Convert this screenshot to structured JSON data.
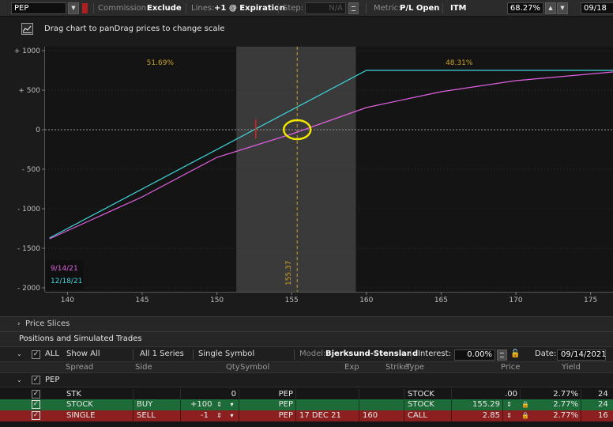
{
  "toolbar": {
    "symbol": "PEP",
    "commission_label": "Commission:",
    "commission_value": "Exclude",
    "lines_label": "Lines:",
    "lines_value": "+1 @ Expiration",
    "step_label": "Step:",
    "step_value": "N/A",
    "metric_label": "Metric:",
    "metric_value": "P/L Open",
    "itm_label": "ITM",
    "itm_value": "68.27%",
    "date_value": "09/18"
  },
  "hint": {
    "text": "Drag chart to panDrag prices to change scale"
  },
  "chart_data": {
    "type": "line",
    "x_ticks": [
      140,
      145,
      150,
      155,
      160,
      165,
      170,
      175
    ],
    "y_ticks": [
      "+ 1000",
      "+ 500",
      "0",
      "- 500",
      "- 1000",
      "- 1500",
      "- 2000"
    ],
    "y_tick_values": [
      1000,
      500,
      0,
      -500,
      -1000,
      -1500,
      -2000
    ],
    "xlim": [
      138.5,
      176.5
    ],
    "ylim": [
      -2050,
      1050
    ],
    "shaded_range": [
      151.3,
      159.3
    ],
    "current_price": 155.37,
    "current_price_label": "155.37",
    "breakeven_marker_x": 152.6,
    "probability_left": "51.69%",
    "probability_right": "48.31%",
    "series": [
      {
        "name": "9/14/21",
        "color": "#e060e0",
        "points": [
          [
            138.8,
            -1380
          ],
          [
            145,
            -850
          ],
          [
            150,
            -350
          ],
          [
            155,
            -55
          ],
          [
            160,
            280
          ],
          [
            165,
            480
          ],
          [
            170,
            620
          ],
          [
            176.5,
            730
          ]
        ]
      },
      {
        "name": "12/18/21",
        "color": "#3fd6dc",
        "points": [
          [
            138.8,
            -1370
          ],
          [
            160,
            750
          ],
          [
            176.5,
            750
          ]
        ]
      }
    ]
  },
  "price_slices": {
    "label": "Price Slices"
  },
  "positions": {
    "title": "Positions and Simulated Trades",
    "filters": {
      "all_label": "ALL",
      "show": "Show All",
      "series": "All 1 Series",
      "symbol_filter": "Single Symbol",
      "model_label": "Model:",
      "model_value": "Bjerksund-Stensland",
      "interest_label": "Interest:",
      "interest_value": "0.00%",
      "date_label": "Date:",
      "date_value": "09/14/2021"
    },
    "headers": {
      "spread": "Spread",
      "side": "Side",
      "qty": "Qty",
      "symbol": "Symbol",
      "exp": "Exp",
      "strike": "Strike",
      "type": "Type",
      "price": "Price",
      "yield": "Yield"
    },
    "group": {
      "name": "PEP"
    },
    "rows": [
      {
        "spread": "STK",
        "side": "",
        "qty": "0",
        "symbol": "PEP",
        "exp": "",
        "strike": "",
        "type": "STOCK",
        "price": ".00",
        "yield": "2.77%",
        "extra": "24"
      },
      {
        "spread": "STOCK",
        "side": "BUY",
        "qty": "+100",
        "symbol": "PEP",
        "exp": "",
        "strike": "",
        "type": "STOCK",
        "price": "155.29",
        "yield": "2.77%",
        "extra": "24"
      },
      {
        "spread": "SINGLE",
        "side": "SELL",
        "qty": "-1",
        "symbol": "PEP",
        "exp": "17 DEC 21",
        "strike": "160",
        "type": "CALL",
        "price": "2.85",
        "yield": "2.77%",
        "extra": "16"
      }
    ]
  }
}
